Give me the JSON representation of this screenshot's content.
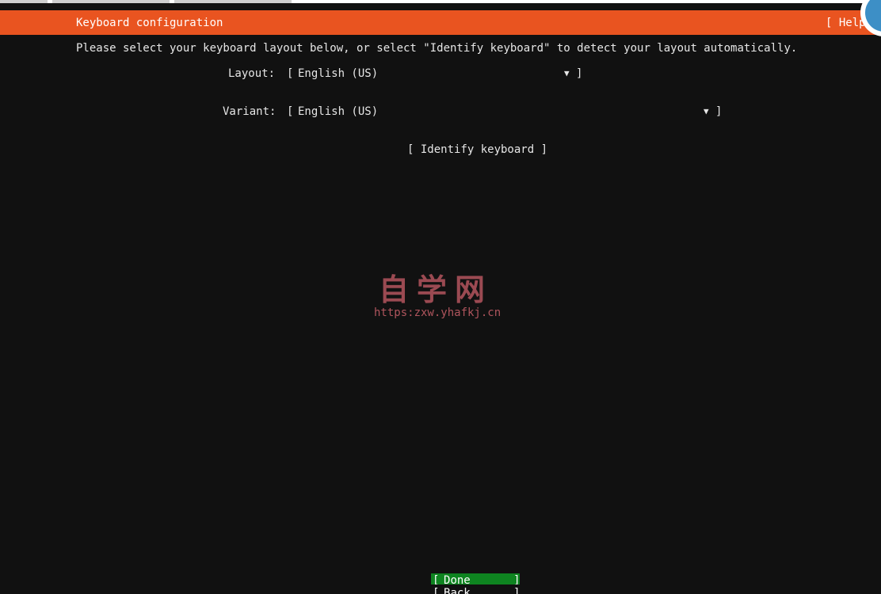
{
  "header": {
    "title": "Keyboard configuration",
    "help_label": "[ Help"
  },
  "intro_text": "Please select your keyboard layout below, or select \"Identify keyboard\" to detect your layout automatically.",
  "form": {
    "layout": {
      "label": "Layout:",
      "value": "English (US)",
      "open_bracket": "[",
      "close_bracket": "]",
      "arrow": "▼"
    },
    "variant": {
      "label": "Variant:",
      "value": "English (US)",
      "open_bracket": "[",
      "close_bracket": "]",
      "arrow": "▼"
    },
    "identify_button": "[ Identify keyboard ]"
  },
  "watermark": {
    "title": "自学网",
    "url": "https:zxw.yhafkj.cn"
  },
  "buttons": {
    "done": {
      "open": "[",
      "label": "Done",
      "close": "]"
    },
    "back": {
      "open": "[",
      "label": "Back",
      "close": "]"
    }
  },
  "colors": {
    "header_bg": "#e95420",
    "page_bg": "#111111",
    "selected_button_bg": "#0e8420",
    "text": "#e6e6e6"
  }
}
